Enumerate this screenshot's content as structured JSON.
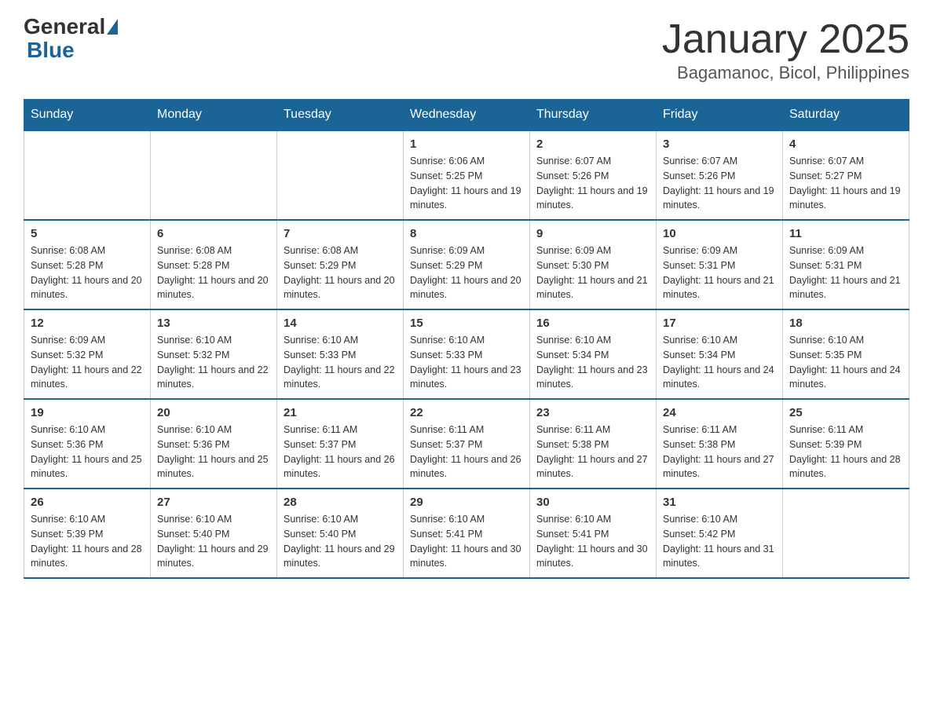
{
  "header": {
    "logo_general": "General",
    "logo_blue": "Blue",
    "title": "January 2025",
    "subtitle": "Bagamanoc, Bicol, Philippines"
  },
  "days_of_week": [
    "Sunday",
    "Monday",
    "Tuesday",
    "Wednesday",
    "Thursday",
    "Friday",
    "Saturday"
  ],
  "weeks": [
    [
      {
        "day": "",
        "sunrise": "",
        "sunset": "",
        "daylight": ""
      },
      {
        "day": "",
        "sunrise": "",
        "sunset": "",
        "daylight": ""
      },
      {
        "day": "",
        "sunrise": "",
        "sunset": "",
        "daylight": ""
      },
      {
        "day": "1",
        "sunrise": "Sunrise: 6:06 AM",
        "sunset": "Sunset: 5:25 PM",
        "daylight": "Daylight: 11 hours and 19 minutes."
      },
      {
        "day": "2",
        "sunrise": "Sunrise: 6:07 AM",
        "sunset": "Sunset: 5:26 PM",
        "daylight": "Daylight: 11 hours and 19 minutes."
      },
      {
        "day": "3",
        "sunrise": "Sunrise: 6:07 AM",
        "sunset": "Sunset: 5:26 PM",
        "daylight": "Daylight: 11 hours and 19 minutes."
      },
      {
        "day": "4",
        "sunrise": "Sunrise: 6:07 AM",
        "sunset": "Sunset: 5:27 PM",
        "daylight": "Daylight: 11 hours and 19 minutes."
      }
    ],
    [
      {
        "day": "5",
        "sunrise": "Sunrise: 6:08 AM",
        "sunset": "Sunset: 5:28 PM",
        "daylight": "Daylight: 11 hours and 20 minutes."
      },
      {
        "day": "6",
        "sunrise": "Sunrise: 6:08 AM",
        "sunset": "Sunset: 5:28 PM",
        "daylight": "Daylight: 11 hours and 20 minutes."
      },
      {
        "day": "7",
        "sunrise": "Sunrise: 6:08 AM",
        "sunset": "Sunset: 5:29 PM",
        "daylight": "Daylight: 11 hours and 20 minutes."
      },
      {
        "day": "8",
        "sunrise": "Sunrise: 6:09 AM",
        "sunset": "Sunset: 5:29 PM",
        "daylight": "Daylight: 11 hours and 20 minutes."
      },
      {
        "day": "9",
        "sunrise": "Sunrise: 6:09 AM",
        "sunset": "Sunset: 5:30 PM",
        "daylight": "Daylight: 11 hours and 21 minutes."
      },
      {
        "day": "10",
        "sunrise": "Sunrise: 6:09 AM",
        "sunset": "Sunset: 5:31 PM",
        "daylight": "Daylight: 11 hours and 21 minutes."
      },
      {
        "day": "11",
        "sunrise": "Sunrise: 6:09 AM",
        "sunset": "Sunset: 5:31 PM",
        "daylight": "Daylight: 11 hours and 21 minutes."
      }
    ],
    [
      {
        "day": "12",
        "sunrise": "Sunrise: 6:09 AM",
        "sunset": "Sunset: 5:32 PM",
        "daylight": "Daylight: 11 hours and 22 minutes."
      },
      {
        "day": "13",
        "sunrise": "Sunrise: 6:10 AM",
        "sunset": "Sunset: 5:32 PM",
        "daylight": "Daylight: 11 hours and 22 minutes."
      },
      {
        "day": "14",
        "sunrise": "Sunrise: 6:10 AM",
        "sunset": "Sunset: 5:33 PM",
        "daylight": "Daylight: 11 hours and 22 minutes."
      },
      {
        "day": "15",
        "sunrise": "Sunrise: 6:10 AM",
        "sunset": "Sunset: 5:33 PM",
        "daylight": "Daylight: 11 hours and 23 minutes."
      },
      {
        "day": "16",
        "sunrise": "Sunrise: 6:10 AM",
        "sunset": "Sunset: 5:34 PM",
        "daylight": "Daylight: 11 hours and 23 minutes."
      },
      {
        "day": "17",
        "sunrise": "Sunrise: 6:10 AM",
        "sunset": "Sunset: 5:34 PM",
        "daylight": "Daylight: 11 hours and 24 minutes."
      },
      {
        "day": "18",
        "sunrise": "Sunrise: 6:10 AM",
        "sunset": "Sunset: 5:35 PM",
        "daylight": "Daylight: 11 hours and 24 minutes."
      }
    ],
    [
      {
        "day": "19",
        "sunrise": "Sunrise: 6:10 AM",
        "sunset": "Sunset: 5:36 PM",
        "daylight": "Daylight: 11 hours and 25 minutes."
      },
      {
        "day": "20",
        "sunrise": "Sunrise: 6:10 AM",
        "sunset": "Sunset: 5:36 PM",
        "daylight": "Daylight: 11 hours and 25 minutes."
      },
      {
        "day": "21",
        "sunrise": "Sunrise: 6:11 AM",
        "sunset": "Sunset: 5:37 PM",
        "daylight": "Daylight: 11 hours and 26 minutes."
      },
      {
        "day": "22",
        "sunrise": "Sunrise: 6:11 AM",
        "sunset": "Sunset: 5:37 PM",
        "daylight": "Daylight: 11 hours and 26 minutes."
      },
      {
        "day": "23",
        "sunrise": "Sunrise: 6:11 AM",
        "sunset": "Sunset: 5:38 PM",
        "daylight": "Daylight: 11 hours and 27 minutes."
      },
      {
        "day": "24",
        "sunrise": "Sunrise: 6:11 AM",
        "sunset": "Sunset: 5:38 PM",
        "daylight": "Daylight: 11 hours and 27 minutes."
      },
      {
        "day": "25",
        "sunrise": "Sunrise: 6:11 AM",
        "sunset": "Sunset: 5:39 PM",
        "daylight": "Daylight: 11 hours and 28 minutes."
      }
    ],
    [
      {
        "day": "26",
        "sunrise": "Sunrise: 6:10 AM",
        "sunset": "Sunset: 5:39 PM",
        "daylight": "Daylight: 11 hours and 28 minutes."
      },
      {
        "day": "27",
        "sunrise": "Sunrise: 6:10 AM",
        "sunset": "Sunset: 5:40 PM",
        "daylight": "Daylight: 11 hours and 29 minutes."
      },
      {
        "day": "28",
        "sunrise": "Sunrise: 6:10 AM",
        "sunset": "Sunset: 5:40 PM",
        "daylight": "Daylight: 11 hours and 29 minutes."
      },
      {
        "day": "29",
        "sunrise": "Sunrise: 6:10 AM",
        "sunset": "Sunset: 5:41 PM",
        "daylight": "Daylight: 11 hours and 30 minutes."
      },
      {
        "day": "30",
        "sunrise": "Sunrise: 6:10 AM",
        "sunset": "Sunset: 5:41 PM",
        "daylight": "Daylight: 11 hours and 30 minutes."
      },
      {
        "day": "31",
        "sunrise": "Sunrise: 6:10 AM",
        "sunset": "Sunset: 5:42 PM",
        "daylight": "Daylight: 11 hours and 31 minutes."
      },
      {
        "day": "",
        "sunrise": "",
        "sunset": "",
        "daylight": ""
      }
    ]
  ]
}
